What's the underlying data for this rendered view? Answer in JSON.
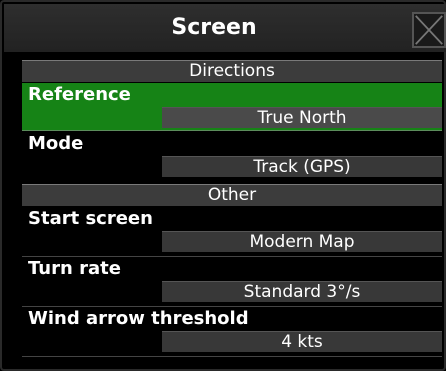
{
  "window": {
    "title": "Screen"
  },
  "sections": [
    {
      "title": "Directions",
      "items": [
        {
          "label": "Reference",
          "value": "True North"
        },
        {
          "label": "Mode",
          "value": "Track (GPS)"
        }
      ]
    },
    {
      "title": "Other",
      "items": [
        {
          "label": "Start screen",
          "value": "Modern Map"
        },
        {
          "label": "Turn rate",
          "value": "Standard 3°/s"
        },
        {
          "label": "Wind arrow threshold",
          "value": "4 kts"
        }
      ]
    }
  ],
  "colors": {
    "highlight": "#168316",
    "section_header": "#3c3c3c",
    "value_box": "#383838"
  }
}
